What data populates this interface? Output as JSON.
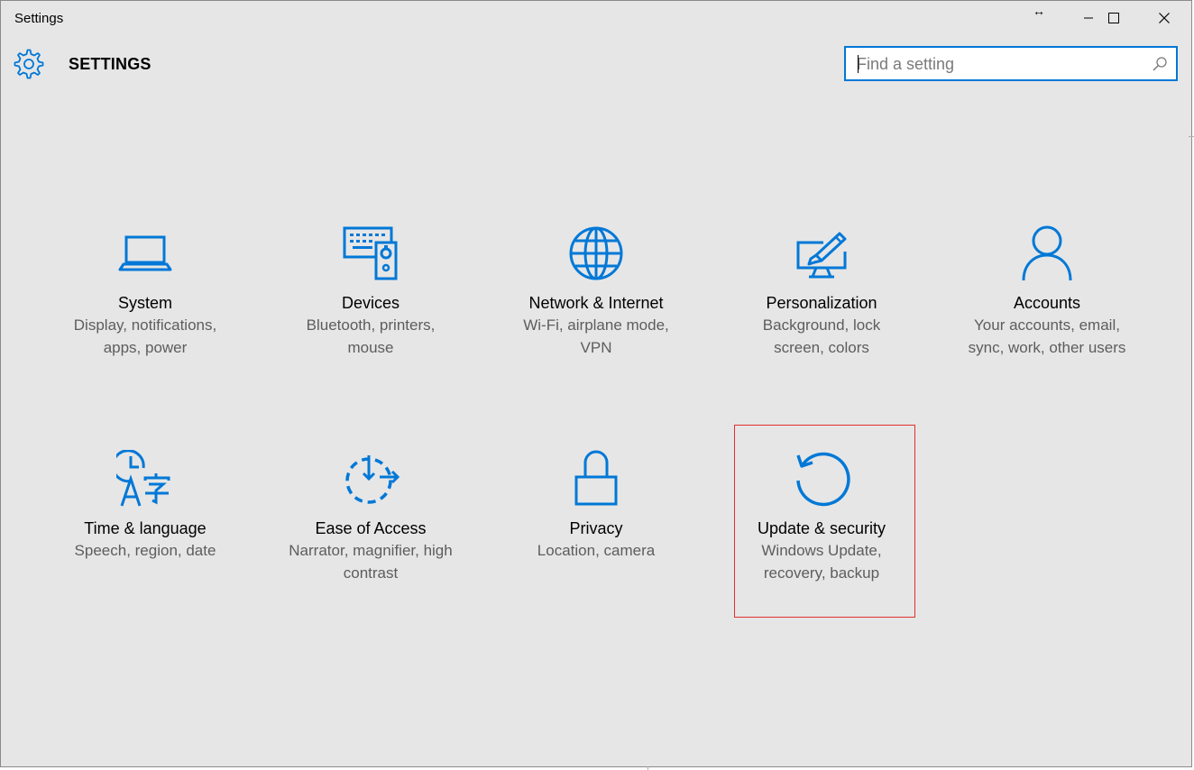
{
  "window": {
    "title": "Settings",
    "resize_glyph": "↔",
    "buttons": {
      "minimize": "minimize-icon",
      "maximize": "maximize-icon",
      "close": "close-icon"
    }
  },
  "header": {
    "title": "SETTINGS",
    "icon": "gear-icon",
    "search": {
      "placeholder": "Find a setting",
      "value": "",
      "icon": "search-icon"
    }
  },
  "accent_color": "#0078d7",
  "highlight_color": "#e0302f",
  "tiles": [
    {
      "name": "System",
      "desc": "Display, notifications, apps, power",
      "icon": "laptop-icon"
    },
    {
      "name": "Devices",
      "desc": "Bluetooth, printers, mouse",
      "icon": "devices-icon"
    },
    {
      "name": "Network & Internet",
      "desc": "Wi-Fi, airplane mode, VPN",
      "icon": "globe-icon"
    },
    {
      "name": "Personalization",
      "desc": "Background, lock screen, colors",
      "icon": "paint-icon"
    },
    {
      "name": "Accounts",
      "desc": "Your accounts, email, sync, work, other users",
      "icon": "person-icon"
    },
    {
      "name": "Time & language",
      "desc": "Speech, region, date",
      "icon": "time-language-icon"
    },
    {
      "name": "Ease of Access",
      "desc": "Narrator, magnifier, high contrast",
      "icon": "ease-of-access-icon"
    },
    {
      "name": "Privacy",
      "desc": "Location, camera",
      "icon": "lock-icon"
    },
    {
      "name": "Update & security",
      "desc": "Windows Update, recovery, backup",
      "icon": "refresh-icon",
      "highlighted": true
    }
  ]
}
